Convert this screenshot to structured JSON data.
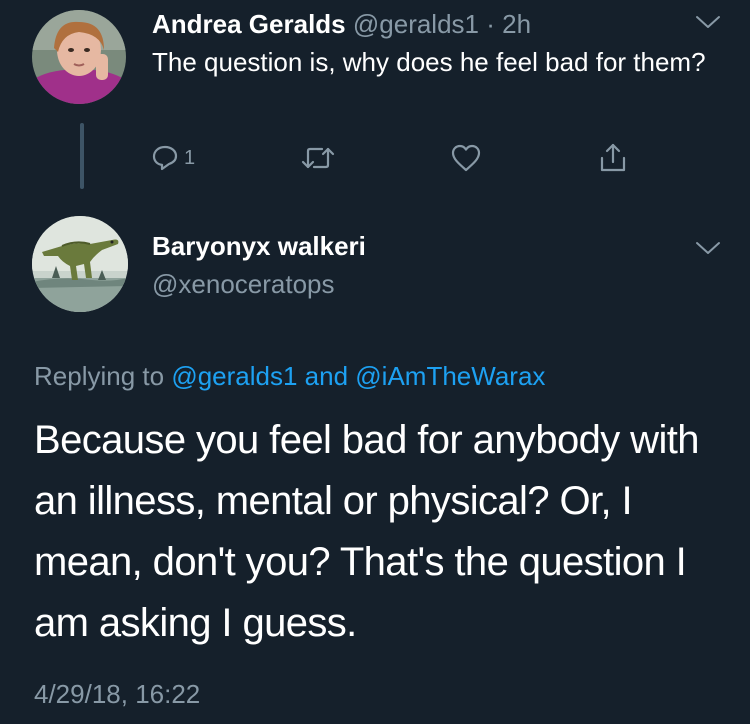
{
  "parent_tweet": {
    "display_name": "Andrea Geralds",
    "handle": "@geralds1",
    "separator": " · ",
    "time": "2h",
    "text": "The question is, why does he feel bad for them?",
    "reply_count": "1",
    "avatar_icon": "user-photo-avatar",
    "menu_icon": "chevron-down-icon"
  },
  "main_tweet": {
    "display_name": "Baryonyx walkeri",
    "handle": "@xenoceratops",
    "replying_prefix": "Replying to ",
    "replying_user_1": "@geralds1",
    "replying_and": " and ",
    "replying_user_2": "@iAmTheWarax",
    "text": "Because you feel bad for anybody with an illness, mental or physical? Or, I mean, don't you? That's the question I am asking I guess.",
    "timestamp": "4/29/18, 16:22",
    "avatar_icon": "dinosaur-avatar",
    "menu_icon": "chevron-down-icon"
  },
  "colors": {
    "background": "#15202b",
    "text": "#ffffff",
    "muted": "#8899a6",
    "link": "#1da1f2",
    "thread_line": "#3d5466"
  }
}
